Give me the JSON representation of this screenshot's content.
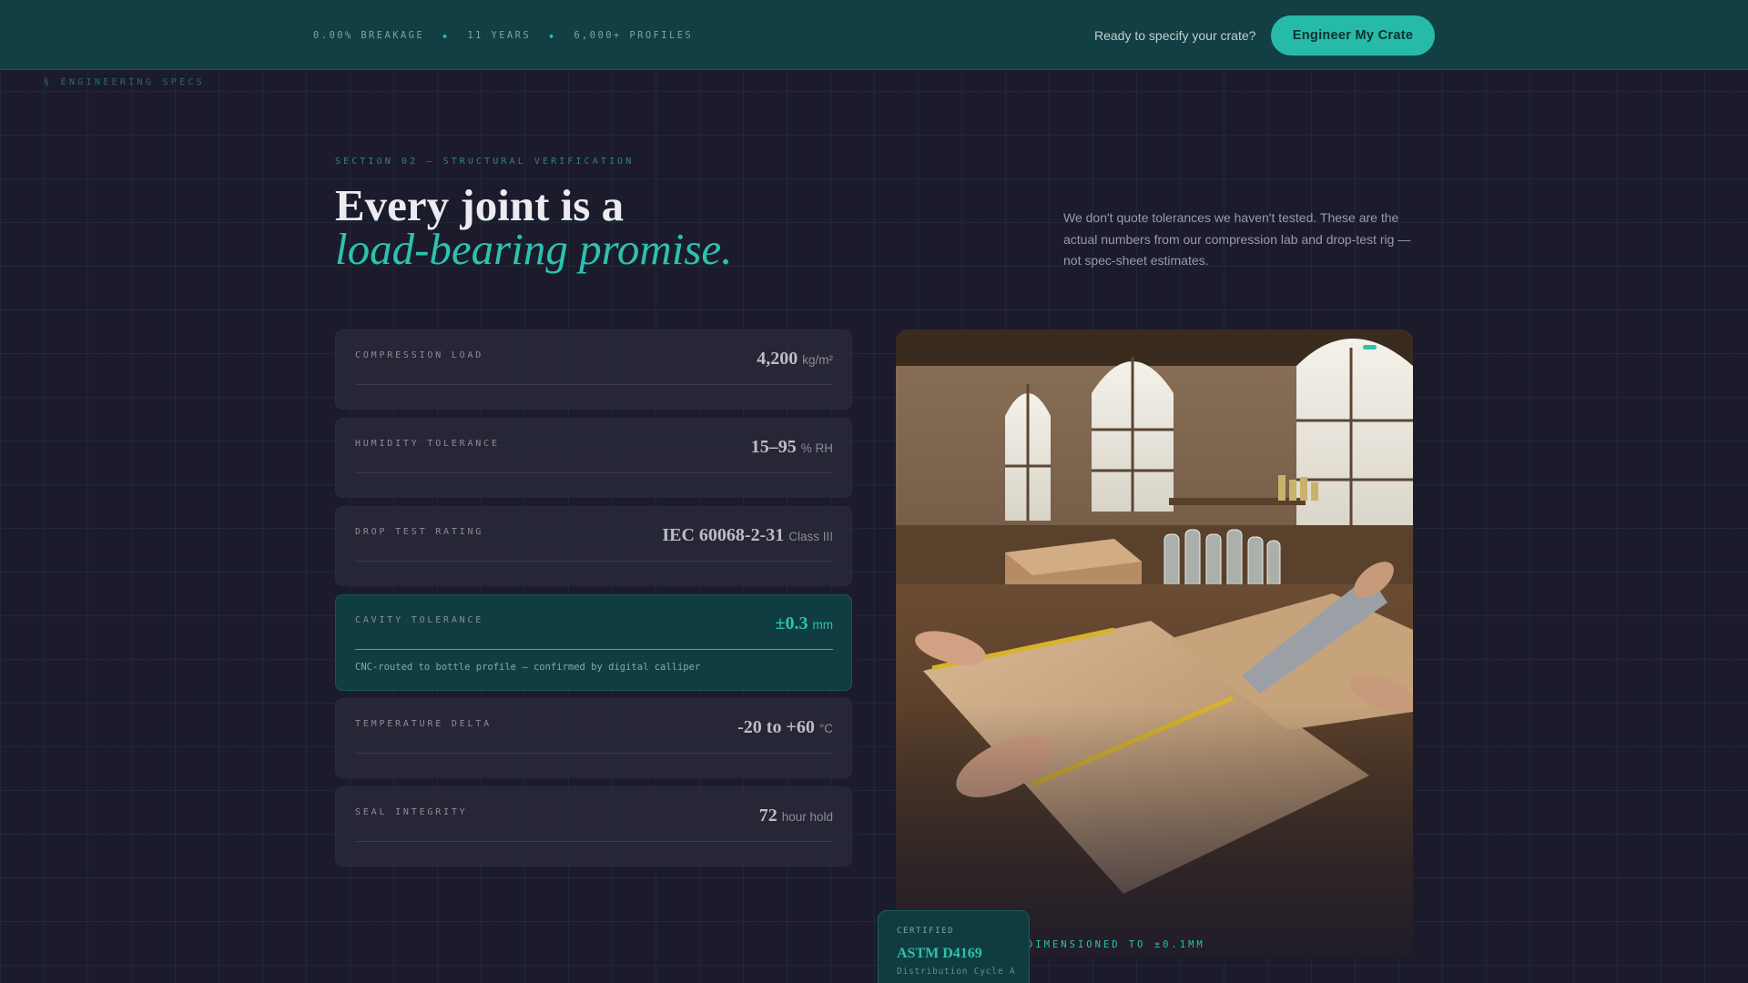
{
  "topbar": {
    "stats": [
      "0.00% BREAKAGE",
      "11 YEARS",
      "6,000+ PROFILES"
    ],
    "separator": "◆",
    "cta_prompt": "Ready to specify your crate?",
    "cta_button": "Engineer My Crate"
  },
  "side_label": "§ ENGINEERING SPECS",
  "section": {
    "eyebrow": "SECTION 02 — STRUCTURAL VERIFICATION",
    "title_line1": "Every joint is a",
    "title_line2": "load-bearing promise.",
    "intro": "We don't quote tolerances we haven't tested. These are the actual numbers from our compression lab and drop-test rig — not spec-sheet estimates."
  },
  "specs": [
    {
      "label": "COMPRESSION LOAD",
      "value": "4,200",
      "unit": "kg/m²"
    },
    {
      "label": "HUMIDITY TOLERANCE",
      "value": "15–95",
      "unit": "% RH"
    },
    {
      "label": "DROP TEST RATING",
      "value": "IEC 60068-2-31",
      "unit": "Class III"
    },
    {
      "label": "CAVITY TOLERANCE",
      "value": "±0.3",
      "unit": "mm",
      "active": true,
      "note": "CNC-routed to bottle profile — confirmed by digital calliper"
    },
    {
      "label": "TEMPERATURE DELTA",
      "value": "-20 to +60",
      "unit": "°C"
    },
    {
      "label": "SEAL INTEGRITY",
      "value": "72",
      "unit": "hour hold"
    }
  ],
  "photo": {
    "caption": "DIMENSIONED TO ±0.1MM",
    "certificate": {
      "label": "CERTIFIED",
      "code": "ASTM D4169",
      "sub": "Distribution Cycle A"
    }
  },
  "colors": {
    "accent": "#2cc2b0",
    "topbar": "#123f43",
    "background": "#1c1b2c"
  }
}
